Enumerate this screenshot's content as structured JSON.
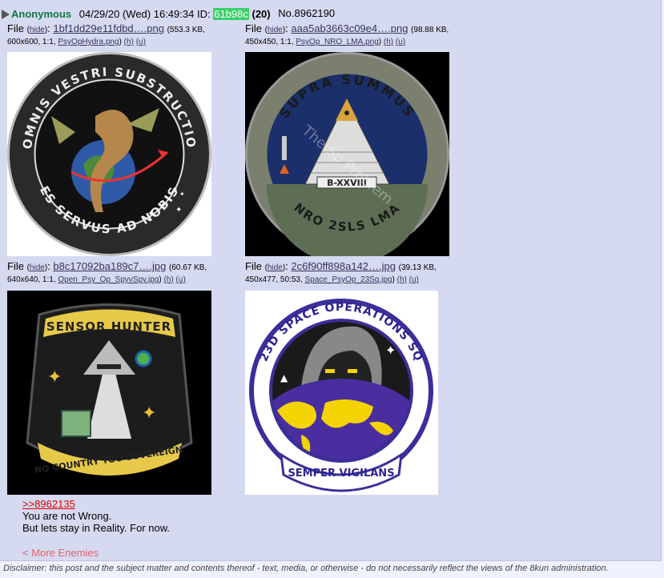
{
  "post": {
    "name": "Anonymous",
    "datetime": "04/29/20 (Wed) 16:49:34",
    "id_label": "ID:",
    "id_value": "61b98c",
    "reply_count": "(20)",
    "post_no": "No.8962190"
  },
  "files": [
    {
      "label": "File",
      "hide": "hide",
      "name": "1bf1dd29e11fdbd….png",
      "size": "(553.3 KB,",
      "dims": "600x600, 1:1,",
      "orig": "PsyOpHydra.png",
      "h": "(h)",
      "u": "(u)",
      "patch_top": "OMNIS VESTRI SUBSTRUCTIO",
      "patch_bottom": "ES SERVUS AD NOBIS"
    },
    {
      "label": "File",
      "hide": "hide",
      "name": "aaa5ab3663c09e4….png",
      "size": "(98.88 KB,",
      "dims": "450x450, 1:1,",
      "orig": "PsyOp_NRO_LMA.png",
      "h": "(h)",
      "u": "(u)",
      "patch_top": "SUPRA SUMMUS",
      "patch_mid": "B-XXVIII",
      "patch_bottom": "NRO 2SLS LMA",
      "watermark": "The Sp   Problem"
    },
    {
      "label": "File",
      "hide": "hide",
      "name": "b8c17092ba189c7….jpg",
      "size": "(60.67 KB,",
      "dims": "640x640, 1:1,",
      "orig": "Open_Psy_Op_SpyvSpy.jpg",
      "h": "(h)",
      "u": "(u)",
      "patch_top": "SENSOR HUNTER",
      "patch_bottom": "NO COUNTRY TOO SOVEREIGN"
    },
    {
      "label": "File",
      "hide": "hide",
      "name": "2c6f90ff898a142….jpg",
      "size": "(39.13 KB,",
      "dims": "450x477, 50:53,",
      "orig": "Space_PsyOp_23Sq.jpg",
      "h": "(h)",
      "u": "(u)",
      "patch_top": "23D SPACE OPERATIONS SQ",
      "patch_bottom": "SEMPER VIGILANS"
    }
  ],
  "body": {
    "quote": ">>8962135",
    "line1": "You are not Wrong.",
    "line2": "But lets stay in Reality. For now."
  },
  "more_link": "< More Enemies",
  "disclaimer": "Disclaimer: this post and the subject matter and contents thereof - text, media, or otherwise - do not necessarily reflect the views of the 8kun administration."
}
